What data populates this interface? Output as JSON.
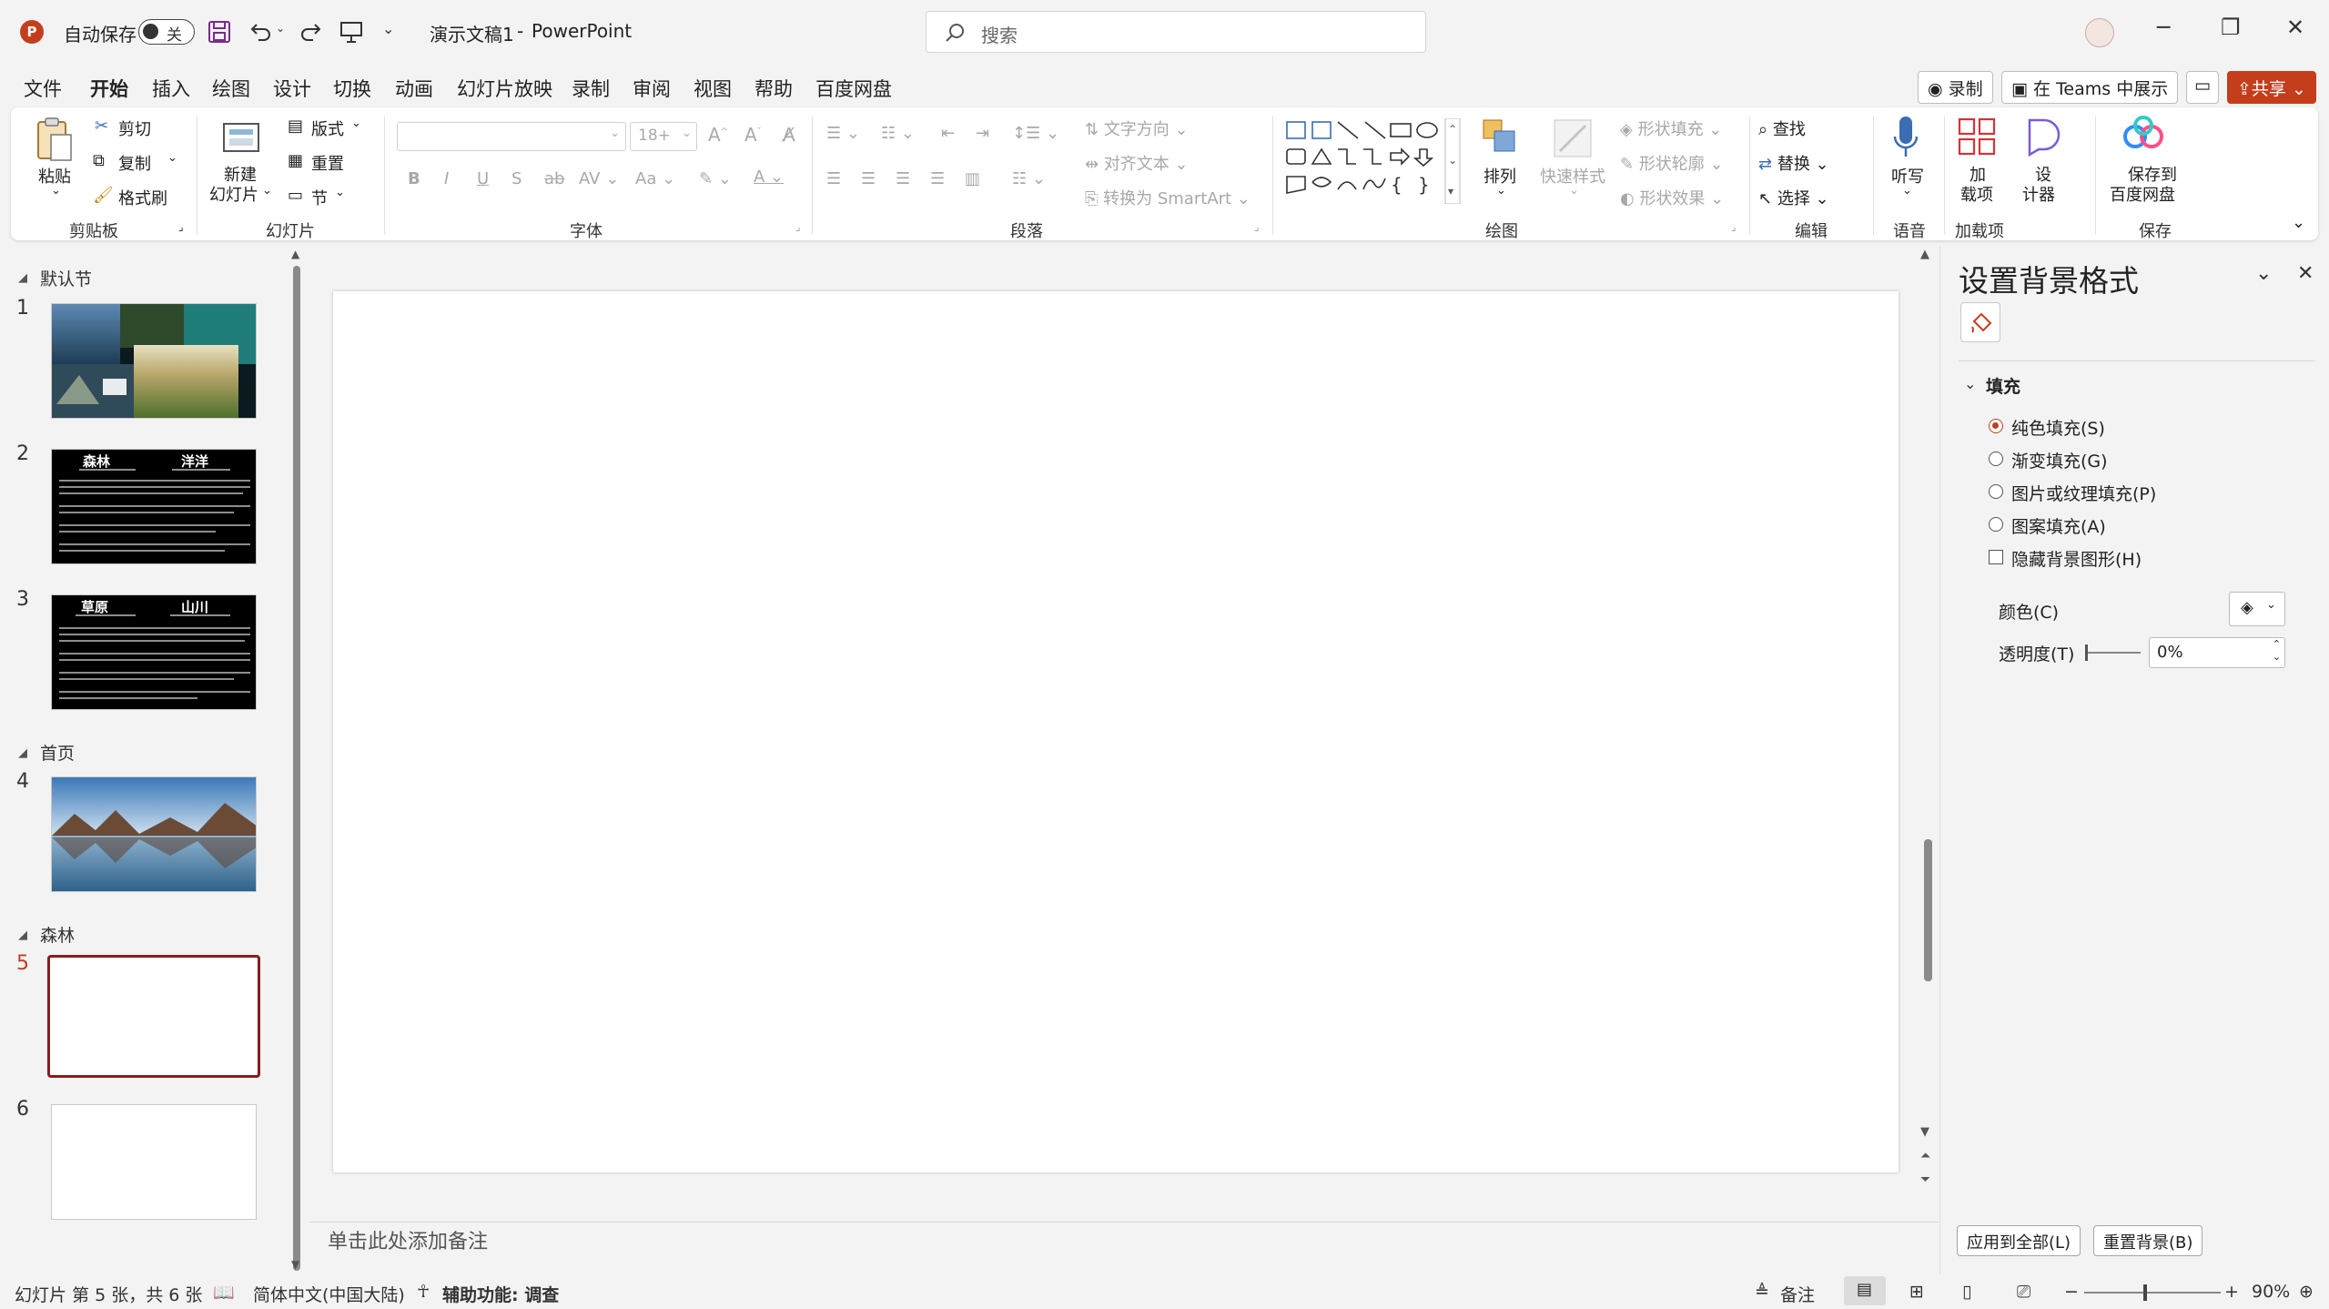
{
  "titlebar": {
    "autosave_label": "自动保存",
    "autosave_state": "关",
    "doc_title": "演示文稿1",
    "separator": "-",
    "app_name": "PowerPoint",
    "search_placeholder": "搜索"
  },
  "menu": {
    "tabs": [
      "文件",
      "开始",
      "插入",
      "绘图",
      "设计",
      "切换",
      "动画",
      "幻灯片放映",
      "录制",
      "审阅",
      "视图",
      "帮助",
      "百度网盘"
    ],
    "active_tab": "开始",
    "record_btn": "录制",
    "teams_btn": "在 Teams 中展示",
    "share_btn": "共享"
  },
  "ribbon": {
    "clipboard": {
      "paste": "粘贴",
      "cut": "剪切",
      "copy": "复制",
      "format_painter": "格式刷",
      "label": "剪贴板"
    },
    "slides": {
      "new_slide_1": "新建",
      "new_slide_2": "幻灯片",
      "layout": "版式",
      "reset": "重置",
      "section": "节",
      "label": "幻灯片"
    },
    "font": {
      "size": "18+",
      "label": "字体"
    },
    "paragraph": {
      "text_direction": "文字方向",
      "align_text": "对齐文本",
      "smartart": "转换为 SmartArt",
      "label": "段落"
    },
    "drawing": {
      "arrange": "排列",
      "quick_styles": "快速样式",
      "shape_fill": "形状填充",
      "shape_outline": "形状轮廓",
      "shape_effects": "形状效果",
      "label": "绘图"
    },
    "editing": {
      "find": "查找",
      "replace": "替换",
      "select": "选择",
      "label": "编辑"
    },
    "voice": {
      "dictate": "听写",
      "label": "语音"
    },
    "addins": {
      "addins_1": "加",
      "addins_2": "载项",
      "label": "加载项"
    },
    "designer": {
      "d1": "设",
      "d2": "计器"
    },
    "save": {
      "s1": "保存到",
      "s2": "百度网盘",
      "label": "保存"
    }
  },
  "slides_panel": {
    "sections": [
      "默认节",
      "首页",
      "森林"
    ],
    "thumb_titles": {
      "slide2": [
        "森林",
        "洋洋"
      ],
      "slide3": [
        "草原",
        "山川"
      ]
    },
    "numbers": [
      "1",
      "2",
      "3",
      "4",
      "5",
      "6"
    ]
  },
  "notes_placeholder": "单击此处添加备注",
  "format_pane": {
    "title": "设置背景格式",
    "fill_section": "填充",
    "options": [
      "纯色填充(S)",
      "渐变填充(G)",
      "图片或纹理填充(P)",
      "图案填充(A)"
    ],
    "selected_option": "纯色填充(S)",
    "hide_bg": "隐藏背景图形(H)",
    "color_label": "颜色(C)",
    "transparency_label": "透明度(T)",
    "transparency_value": "0%",
    "apply_all": "应用到全部(L)",
    "reset_bg": "重置背景(B)"
  },
  "statusbar": {
    "slide_info": "幻灯片 第 5 张，共 6 张",
    "language": "简体中文(中国大陆)",
    "accessibility": "辅助功能: 调查",
    "notes": "备注",
    "zoom": "90%"
  },
  "colors": {
    "accent": "#c43e1c",
    "selected_thumb": "#8b1c1c"
  }
}
